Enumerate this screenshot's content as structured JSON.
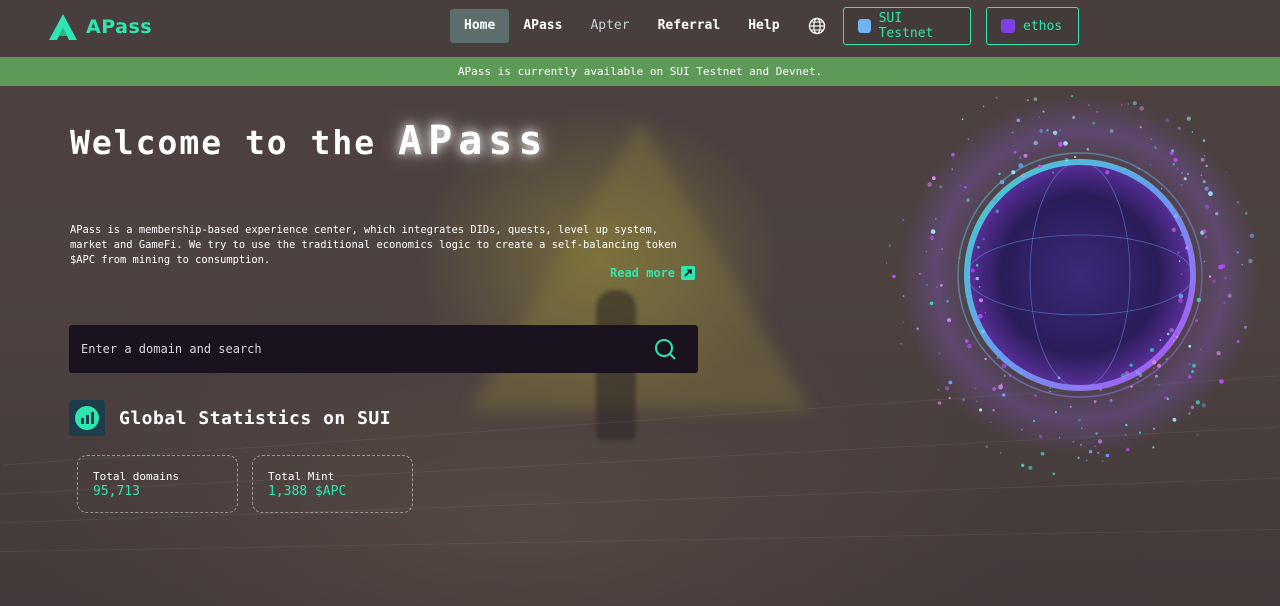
{
  "header": {
    "brand": "APass",
    "nav": [
      {
        "label": "Home",
        "active": true
      },
      {
        "label": "APass"
      },
      {
        "label": "Apter"
      },
      {
        "label": "Referral"
      },
      {
        "label": "Help"
      }
    ],
    "language_icon": "globe-icon",
    "network_label": "SUI Testnet",
    "wallet_label": "ethos"
  },
  "banner": {
    "text": "APass is currently available on SUI Testnet and Devnet."
  },
  "hero": {
    "title_prefix": "Welcome to the",
    "title_brand": "APass",
    "description": "APass is a membership-based experience center, which integrates DIDs, quests, level up system, market and GameFi. We try to use the traditional economics logic to create a self-balancing token $APC from mining to consumption.",
    "read_more": "Read more"
  },
  "search": {
    "placeholder": "Enter a domain and search"
  },
  "stats": {
    "title": "Global Statistics on SUI",
    "cards": [
      {
        "label": "Total domains",
        "value": "95,713"
      },
      {
        "label": "Total Mint",
        "value": "1,388 $APC"
      }
    ]
  },
  "colors": {
    "accent": "#2ee6b0",
    "banner": "#5e9a57",
    "header_bg": "#483e3e",
    "search_bg": "#1b1220"
  }
}
